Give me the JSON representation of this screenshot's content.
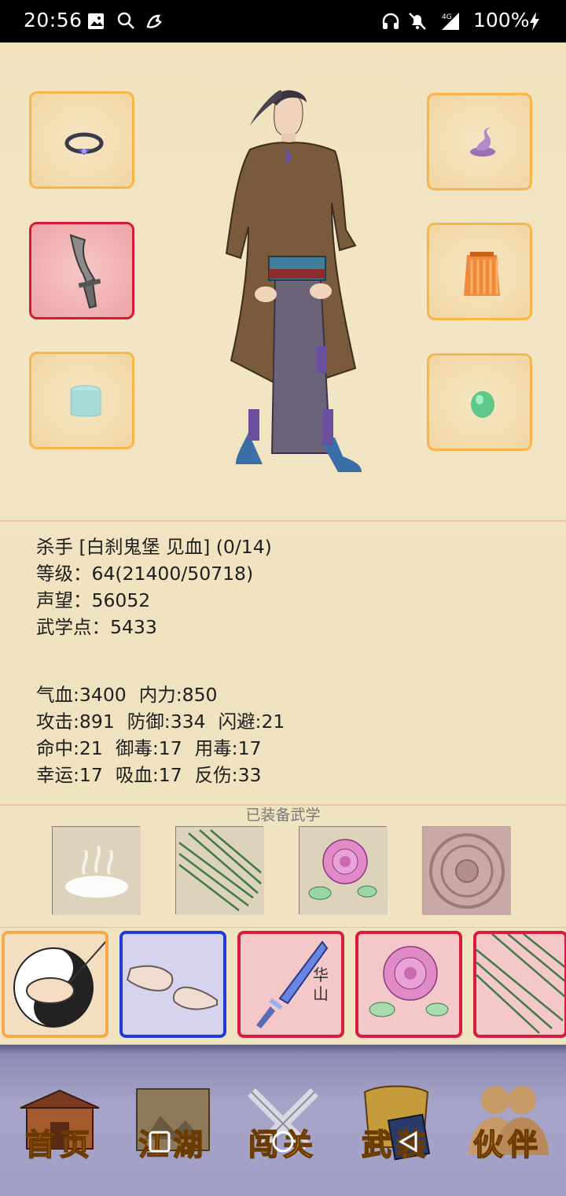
{
  "status_bar": {
    "time": "20:56",
    "battery": "100%"
  },
  "profile": {
    "title_line": "杀手 [白刹鬼堡 见血] (0/14)",
    "level_line": "等级：64(21400/50718)",
    "fame_line": "声望：56052",
    "martial_points_line": "武学点：5433"
  },
  "stats": [
    [
      "气血:3400",
      "内力:850"
    ],
    [
      "攻击:891",
      "防御:334",
      "闪避:21"
    ],
    [
      "命中:21",
      "御毒:17",
      "用毒:17"
    ],
    [
      "幸运:17",
      "吸血:17",
      "反伤:33"
    ]
  ],
  "equipped_martial_title": "已装备武学",
  "skill_card_huashan_text": "华山",
  "nav": [
    {
      "label": "首页",
      "icon": "house-icon"
    },
    {
      "label": "江湖",
      "icon": "scroll-map-icon"
    },
    {
      "label": "闯关",
      "icon": "crossed-swords-icon"
    },
    {
      "label": "武装",
      "icon": "armor-book-icon"
    },
    {
      "label": "伙伴",
      "icon": "partners-icon"
    }
  ],
  "colors": {
    "slot_border": "#f7b54a",
    "slot_red": "#d21b3a",
    "nav_text": "#f2c12e",
    "skill_blue": "#1f3bd6"
  }
}
